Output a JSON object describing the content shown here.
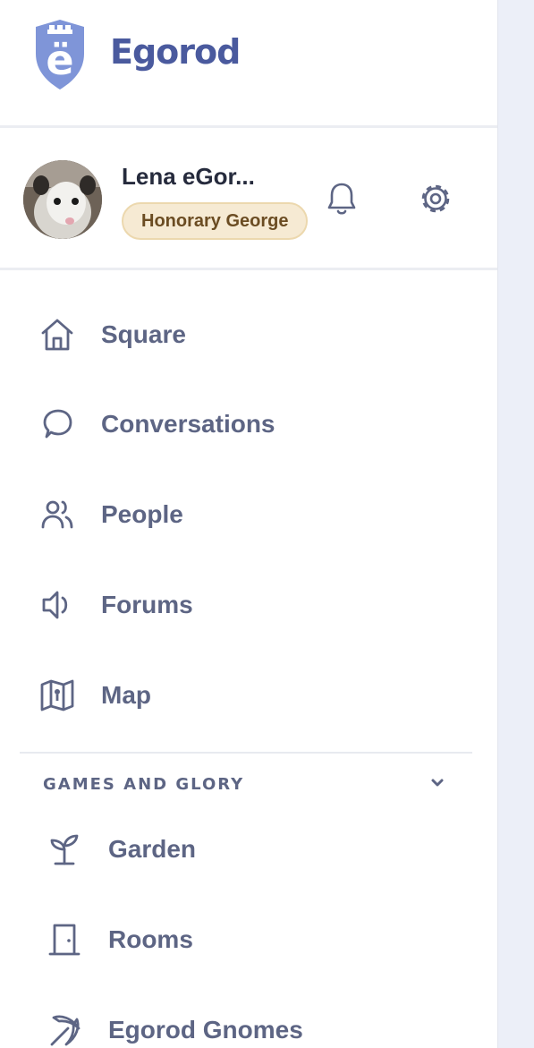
{
  "brand": {
    "name": "Egorod",
    "logo_letter": "ë",
    "logo_color": "#7f95d8",
    "name_color": "#4a5a9e"
  },
  "profile": {
    "user_name": "Lena eGor...",
    "badge": "Honorary George",
    "avatar_icon": "possum-avatar",
    "actions": [
      "bell-icon",
      "gear-icon"
    ]
  },
  "nav": {
    "items": [
      {
        "label": "Square",
        "icon": "house-icon"
      },
      {
        "label": "Conversations",
        "icon": "chat-bubble-icon"
      },
      {
        "label": "People",
        "icon": "people-icon"
      },
      {
        "label": "Forums",
        "icon": "megaphone-icon"
      },
      {
        "label": "Map",
        "icon": "map-icon"
      }
    ]
  },
  "section": {
    "title": "GAMES AND GLORY",
    "chevron": "chevron-down-icon",
    "items": [
      {
        "label": "Garden",
        "icon": "sprout-icon"
      },
      {
        "label": "Rooms",
        "icon": "door-icon"
      },
      {
        "label": "Egorod Gnomes",
        "icon": "pickaxe-icon"
      }
    ]
  },
  "colors": {
    "nav_text": "#5d6584",
    "badge_bg": "#f6ead3",
    "badge_text": "#6b4c22",
    "page_bg": "#eceff8"
  }
}
